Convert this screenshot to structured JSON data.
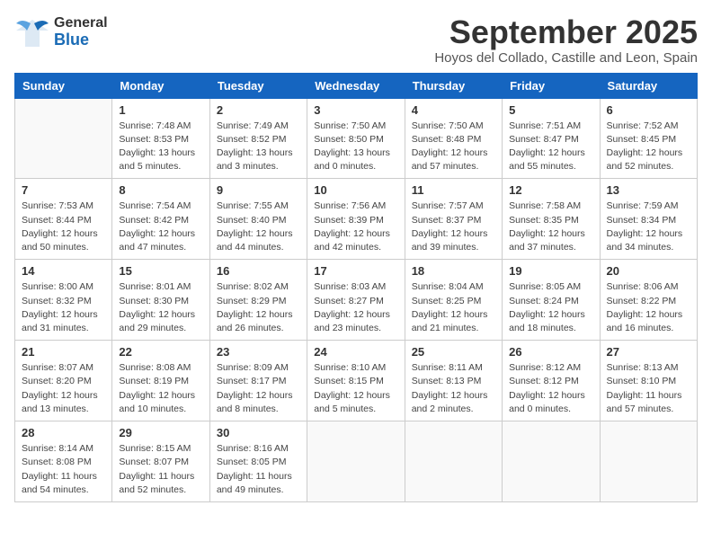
{
  "header": {
    "logo_general": "General",
    "logo_blue": "Blue",
    "month": "September 2025",
    "location": "Hoyos del Collado, Castille and Leon, Spain"
  },
  "weekdays": [
    "Sunday",
    "Monday",
    "Tuesday",
    "Wednesday",
    "Thursday",
    "Friday",
    "Saturday"
  ],
  "weeks": [
    [
      {
        "day": "",
        "info": ""
      },
      {
        "day": "1",
        "info": "Sunrise: 7:48 AM\nSunset: 8:53 PM\nDaylight: 13 hours\nand 5 minutes."
      },
      {
        "day": "2",
        "info": "Sunrise: 7:49 AM\nSunset: 8:52 PM\nDaylight: 13 hours\nand 3 minutes."
      },
      {
        "day": "3",
        "info": "Sunrise: 7:50 AM\nSunset: 8:50 PM\nDaylight: 13 hours\nand 0 minutes."
      },
      {
        "day": "4",
        "info": "Sunrise: 7:50 AM\nSunset: 8:48 PM\nDaylight: 12 hours\nand 57 minutes."
      },
      {
        "day": "5",
        "info": "Sunrise: 7:51 AM\nSunset: 8:47 PM\nDaylight: 12 hours\nand 55 minutes."
      },
      {
        "day": "6",
        "info": "Sunrise: 7:52 AM\nSunset: 8:45 PM\nDaylight: 12 hours\nand 52 minutes."
      }
    ],
    [
      {
        "day": "7",
        "info": "Sunrise: 7:53 AM\nSunset: 8:44 PM\nDaylight: 12 hours\nand 50 minutes."
      },
      {
        "day": "8",
        "info": "Sunrise: 7:54 AM\nSunset: 8:42 PM\nDaylight: 12 hours\nand 47 minutes."
      },
      {
        "day": "9",
        "info": "Sunrise: 7:55 AM\nSunset: 8:40 PM\nDaylight: 12 hours\nand 44 minutes."
      },
      {
        "day": "10",
        "info": "Sunrise: 7:56 AM\nSunset: 8:39 PM\nDaylight: 12 hours\nand 42 minutes."
      },
      {
        "day": "11",
        "info": "Sunrise: 7:57 AM\nSunset: 8:37 PM\nDaylight: 12 hours\nand 39 minutes."
      },
      {
        "day": "12",
        "info": "Sunrise: 7:58 AM\nSunset: 8:35 PM\nDaylight: 12 hours\nand 37 minutes."
      },
      {
        "day": "13",
        "info": "Sunrise: 7:59 AM\nSunset: 8:34 PM\nDaylight: 12 hours\nand 34 minutes."
      }
    ],
    [
      {
        "day": "14",
        "info": "Sunrise: 8:00 AM\nSunset: 8:32 PM\nDaylight: 12 hours\nand 31 minutes."
      },
      {
        "day": "15",
        "info": "Sunrise: 8:01 AM\nSunset: 8:30 PM\nDaylight: 12 hours\nand 29 minutes."
      },
      {
        "day": "16",
        "info": "Sunrise: 8:02 AM\nSunset: 8:29 PM\nDaylight: 12 hours\nand 26 minutes."
      },
      {
        "day": "17",
        "info": "Sunrise: 8:03 AM\nSunset: 8:27 PM\nDaylight: 12 hours\nand 23 minutes."
      },
      {
        "day": "18",
        "info": "Sunrise: 8:04 AM\nSunset: 8:25 PM\nDaylight: 12 hours\nand 21 minutes."
      },
      {
        "day": "19",
        "info": "Sunrise: 8:05 AM\nSunset: 8:24 PM\nDaylight: 12 hours\nand 18 minutes."
      },
      {
        "day": "20",
        "info": "Sunrise: 8:06 AM\nSunset: 8:22 PM\nDaylight: 12 hours\nand 16 minutes."
      }
    ],
    [
      {
        "day": "21",
        "info": "Sunrise: 8:07 AM\nSunset: 8:20 PM\nDaylight: 12 hours\nand 13 minutes."
      },
      {
        "day": "22",
        "info": "Sunrise: 8:08 AM\nSunset: 8:19 PM\nDaylight: 12 hours\nand 10 minutes."
      },
      {
        "day": "23",
        "info": "Sunrise: 8:09 AM\nSunset: 8:17 PM\nDaylight: 12 hours\nand 8 minutes."
      },
      {
        "day": "24",
        "info": "Sunrise: 8:10 AM\nSunset: 8:15 PM\nDaylight: 12 hours\nand 5 minutes."
      },
      {
        "day": "25",
        "info": "Sunrise: 8:11 AM\nSunset: 8:13 PM\nDaylight: 12 hours\nand 2 minutes."
      },
      {
        "day": "26",
        "info": "Sunrise: 8:12 AM\nSunset: 8:12 PM\nDaylight: 12 hours\nand 0 minutes."
      },
      {
        "day": "27",
        "info": "Sunrise: 8:13 AM\nSunset: 8:10 PM\nDaylight: 11 hours\nand 57 minutes."
      }
    ],
    [
      {
        "day": "28",
        "info": "Sunrise: 8:14 AM\nSunset: 8:08 PM\nDaylight: 11 hours\nand 54 minutes."
      },
      {
        "day": "29",
        "info": "Sunrise: 8:15 AM\nSunset: 8:07 PM\nDaylight: 11 hours\nand 52 minutes."
      },
      {
        "day": "30",
        "info": "Sunrise: 8:16 AM\nSunset: 8:05 PM\nDaylight: 11 hours\nand 49 minutes."
      },
      {
        "day": "",
        "info": ""
      },
      {
        "day": "",
        "info": ""
      },
      {
        "day": "",
        "info": ""
      },
      {
        "day": "",
        "info": ""
      }
    ]
  ]
}
